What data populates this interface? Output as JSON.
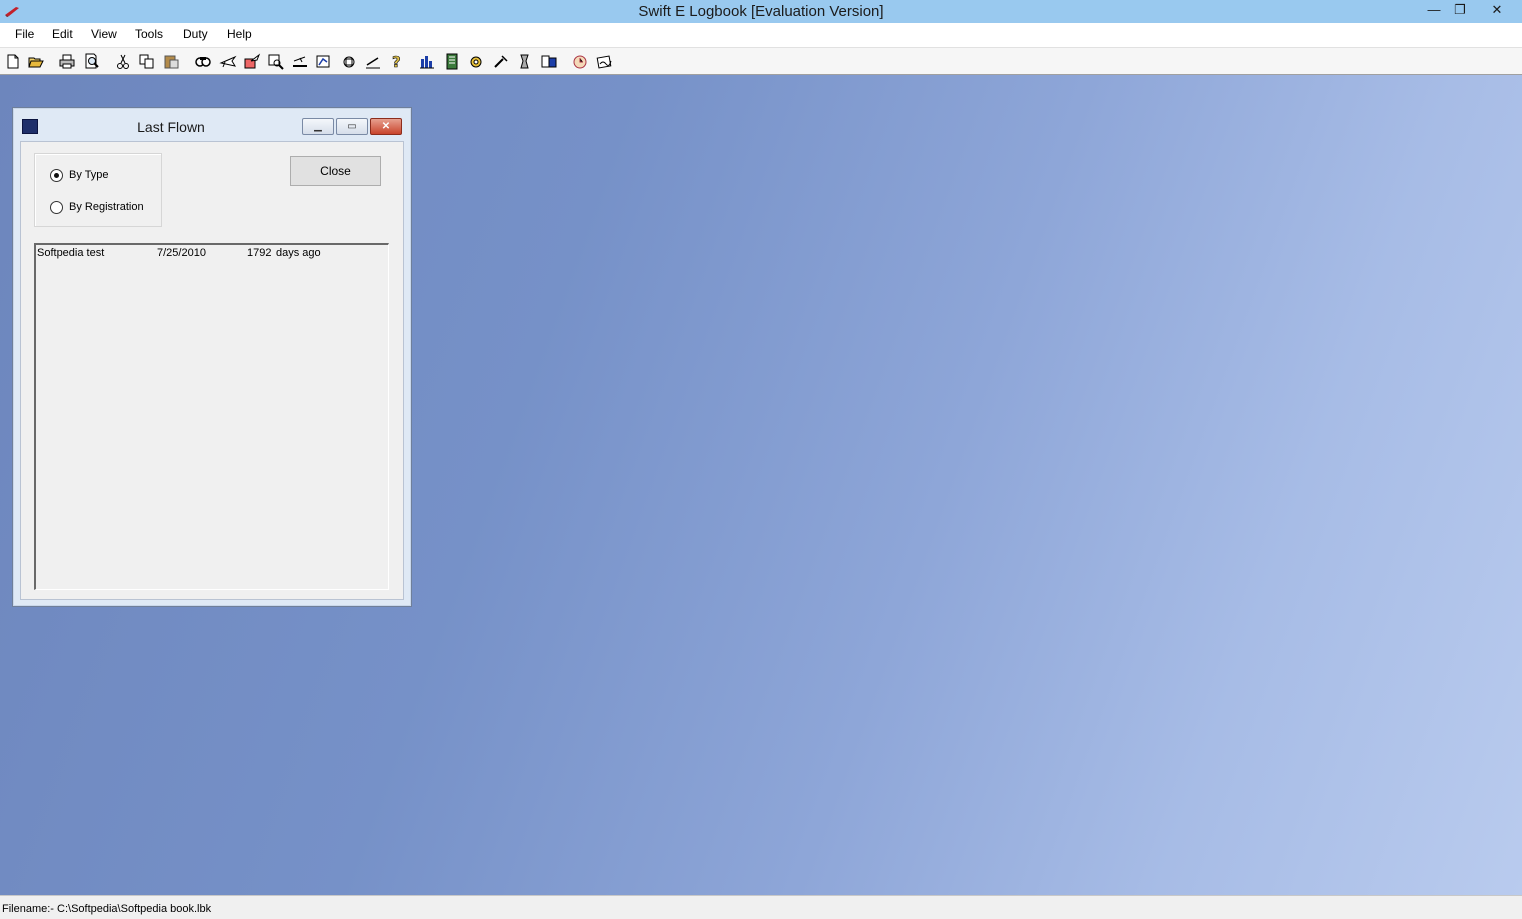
{
  "window": {
    "title": "Swift E Logbook [Evaluation Version]",
    "minimize_glyph": "—",
    "restore_glyph": "❐",
    "close_glyph": "✕"
  },
  "menu": [
    "File",
    "Edit",
    "View",
    "Tools",
    "Duty",
    "Help"
  ],
  "toolbar_icons": [
    "new-icon",
    "open-icon",
    "print-icon",
    "print-preview-icon",
    "cut-icon",
    "copy-icon",
    "paste-icon",
    "find-icon",
    "airplane-icon",
    "aircraft-list-icon",
    "search-icon",
    "landing-icon",
    "chart-icon",
    "export-icon",
    "help-icon",
    "bar-chart-icon",
    "notebook-icon",
    "gear-icon",
    "tools-icon",
    "flight-time-icon",
    "expenses-icon",
    "clock-icon",
    "signature-icon"
  ],
  "dialog": {
    "title": "Last Flown",
    "minimize_glyph": "▁",
    "restore_glyph": "▭",
    "close_glyph": "✕",
    "radio_by_type": "By Type",
    "radio_by_registration": "By Registration",
    "selected": "By Type",
    "close_button": "Close",
    "list": [
      {
        "name": "Softpedia test",
        "date": "7/25/2010",
        "days": "1792",
        "suffix": "days ago"
      }
    ]
  },
  "status": {
    "filename": "Filename:- C:\\Softpedia\\Softpedia book.lbk"
  },
  "colors": {
    "titlebar": "#99c9ef",
    "mdi_background": "#7691c8",
    "dialog_frame": "#dfe9f5",
    "close_red": "#c9442c"
  }
}
